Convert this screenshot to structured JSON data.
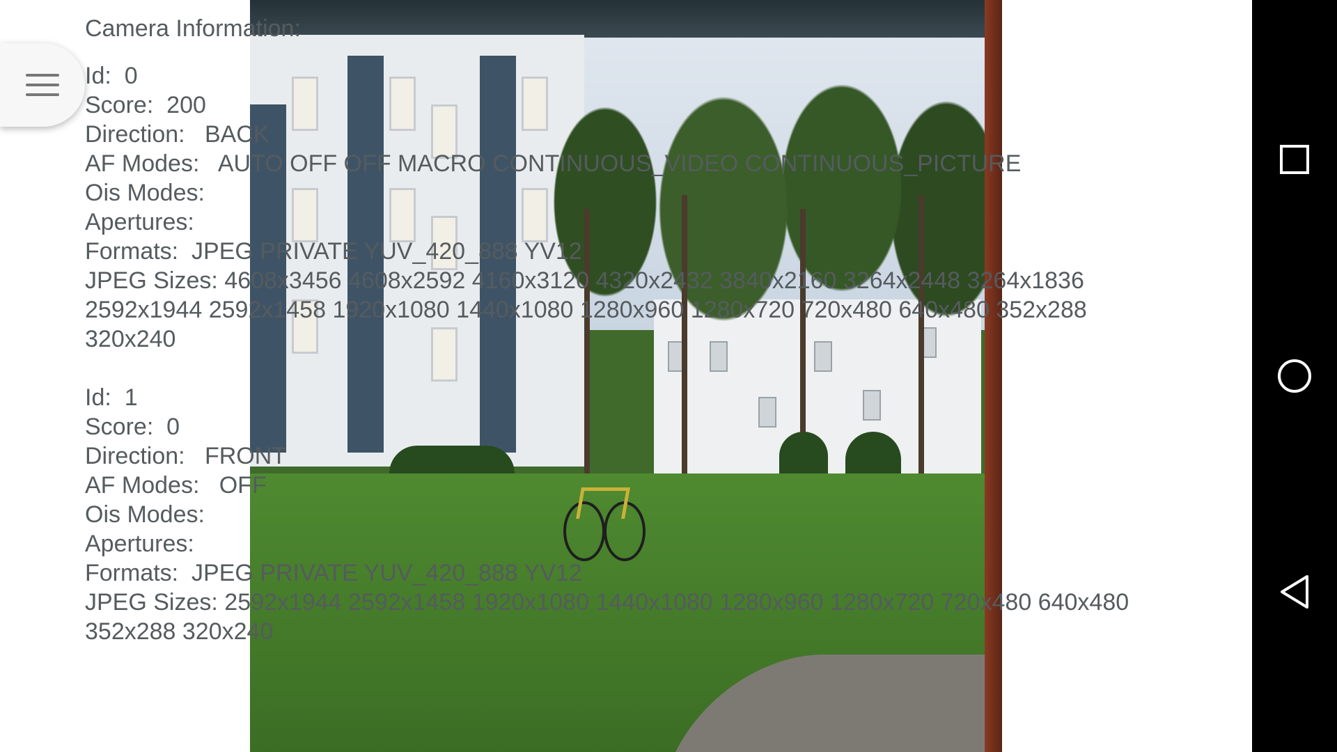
{
  "camera_info": {
    "title": "Camera Information:",
    "cameras": [
      {
        "id": "Id:  0",
        "score": "Score:  200",
        "direction": "Direction:   BACK",
        "af_modes": "AF Modes:   AUTO OFF OFF MACRO CONTINUOUS_VIDEO CONTINUOUS_PICTURE",
        "ois_modes": "Ois Modes:",
        "apertures": "Apertures:",
        "formats": "Formats:  JPEG PRIVATE YUV_420_888 YV12",
        "jpeg_sizes": "JPEG Sizes:   4608x3456 4608x2592 4160x3120 4320x2432 3840x2160 3264x2448 3264x1836 2592x1944 2592x1458 1920x1080 1440x1080 1280x960 1280x720 720x480 640x480 352x288 320x240"
      },
      {
        "id": "Id:  1",
        "score": "Score:  0",
        "direction": "Direction:   FRONT",
        "af_modes": "AF Modes:   OFF",
        "ois_modes": "Ois Modes:",
        "apertures": "Apertures:",
        "formats": "Formats:  JPEG PRIVATE YUV_420_888 YV12",
        "jpeg_sizes": "JPEG Sizes:   2592x1944 2592x1458 1920x1080 1440x1080 1280x960 1280x720 720x480 640x480 352x288 320x240"
      }
    ]
  },
  "menu_button": {
    "icon": "hamburger-menu-icon"
  },
  "nav_bar": {
    "recents_icon": "square-recents-icon",
    "home_icon": "circle-home-icon",
    "back_icon": "triangle-back-icon",
    "color": "#000000"
  },
  "preview": {
    "description_icon": "camera-preview"
  }
}
